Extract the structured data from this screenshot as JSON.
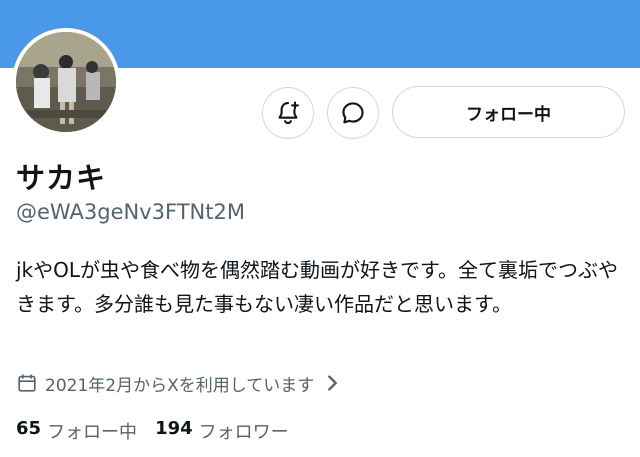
{
  "colors": {
    "banner": "#4a99e9",
    "secondary_text": "#536471",
    "primary_text": "#0f1419",
    "border": "#cfd9de"
  },
  "actions": {
    "notify_icon": "bell-plus-icon",
    "message_icon": "message-icon",
    "follow_label": "フォロー中"
  },
  "profile": {
    "display_name": "サカキ",
    "handle": "@eWA3geNv3FTNt2M",
    "bio": "jkやOLが虫や食べ物を偶然踏む動画が好きです。全て裏垢でつぶやきます。多分誰も見た事もない凄い作品だと思います。",
    "joined_icon": "calendar-icon",
    "joined_text": "2021年2月からXを利用しています"
  },
  "stats": {
    "following_count": "65",
    "following_label": "フォロー中",
    "followers_count": "194",
    "followers_label": "フォロワー"
  }
}
